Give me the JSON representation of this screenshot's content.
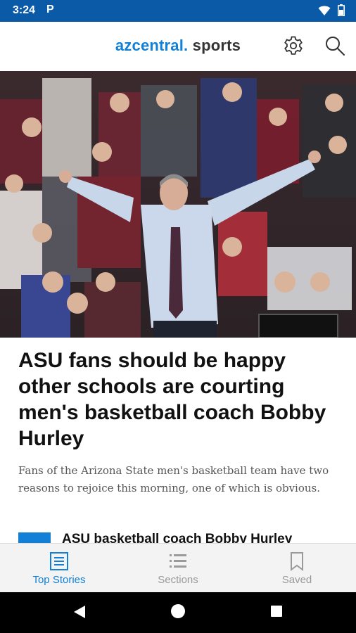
{
  "status": {
    "time": "3:24",
    "app_indicator": "P"
  },
  "header": {
    "brand_az": "az",
    "brand_central": "central.",
    "brand_sports": " sports",
    "settings_icon": "gear-icon",
    "search_icon": "search-icon"
  },
  "article": {
    "headline": "ASU fans should be happy other schools are courting men's basketball coach Bobby Hurley",
    "summary": "Fans of the Arizona State men's basketball team have two reasons to rejoice this morning, one of which is obvious."
  },
  "next_story": {
    "title": "ASU basketball coach Bobby Hurley"
  },
  "bottom_nav": {
    "items": [
      {
        "label": "Top Stories",
        "icon": "news-icon",
        "active": true
      },
      {
        "label": "Sections",
        "icon": "list-icon",
        "active": false
      },
      {
        "label": "Saved",
        "icon": "bookmark-icon",
        "active": false
      }
    ]
  },
  "colors": {
    "status_bar": "#0a5aa8",
    "brand_blue": "#1180d6",
    "nav_background": "#f3f3f3"
  }
}
